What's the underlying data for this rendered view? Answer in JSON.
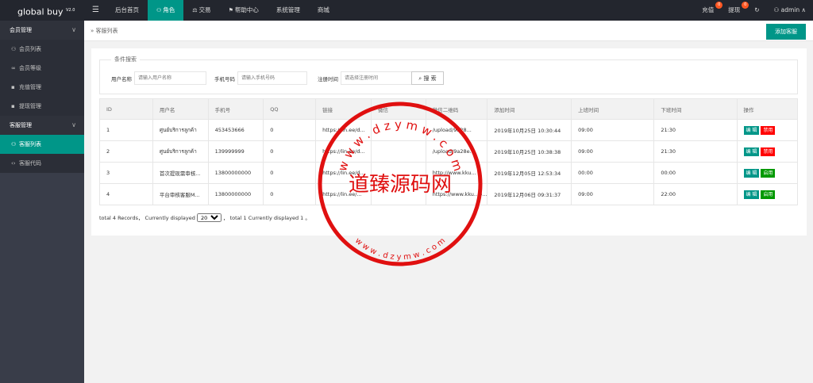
{
  "app": {
    "name": "global buy",
    "version": "V2.0"
  },
  "header": {
    "menu_icon": "menu-icon",
    "nav": [
      {
        "label": "后台首页",
        "icon": ""
      },
      {
        "label": "角色",
        "icon": "user-icon"
      },
      {
        "label": "交易",
        "icon": "scale-icon"
      },
      {
        "label": "帮助中心",
        "icon": "flag-icon"
      },
      {
        "label": "系统管理",
        "icon": ""
      },
      {
        "label": "商城",
        "icon": ""
      }
    ],
    "right": {
      "recharge": {
        "label": "充值",
        "badge": "0"
      },
      "withdraw": {
        "label": "提现",
        "badge": "0"
      },
      "refresh_icon": "refresh-icon",
      "user": {
        "label": "admin",
        "icon": "user-icon"
      }
    }
  },
  "sidebar": {
    "groups": [
      {
        "label": "会员管理",
        "items": [
          {
            "label": "会员列表",
            "icon": "user-icon"
          },
          {
            "label": "会员等级",
            "icon": "link-icon"
          },
          {
            "label": "充值管理",
            "icon": "chat-icon"
          },
          {
            "label": "提现管理",
            "icon": "chat-icon"
          }
        ]
      },
      {
        "label": "客服管理",
        "items": [
          {
            "label": "客服列表",
            "icon": "users-icon",
            "active": true
          },
          {
            "label": "客服代码",
            "icon": "code-icon"
          }
        ]
      }
    ]
  },
  "breadcrumb": {
    "label": "客服列表"
  },
  "toolbar": {
    "add_label": "添加客服"
  },
  "search": {
    "legend": "条件搜索",
    "username": {
      "label": "用户名称",
      "placeholder": "请输入用户名称"
    },
    "phone": {
      "label": "手机号码",
      "placeholder": "请输入手机号码"
    },
    "regtime": {
      "label": "注册时间",
      "placeholder": "请选择注册时间"
    },
    "button": "搜 索"
  },
  "table": {
    "headers": [
      "ID",
      "用户名",
      "手机号",
      "QQ",
      "链接",
      "微信",
      "微信二维码",
      "添加时间",
      "上班时间",
      "下班时间",
      "操作"
    ],
    "rows": [
      {
        "id": "1",
        "name": "ศูนย์บริการลูกค้า",
        "phone": "453453666",
        "qq": "0",
        "link": "https://lin.ee/d...",
        "wechat": "",
        "qr": "/upload/9a28...",
        "added": "2019年10月25日 10:30:44",
        "start": "09:00",
        "end": "21:30",
        "edit": "编 辑",
        "toggle": "禁用",
        "toggle_type": "off"
      },
      {
        "id": "2",
        "name": "ศูนย์บริการลูกค้า",
        "phone": "139999999",
        "qq": "0",
        "link": "https://lin.ee/d...",
        "wechat": "",
        "qr": "/upload/9a28e...",
        "added": "2019年10月25日 10:38:38",
        "start": "09:00",
        "end": "21:30",
        "edit": "编 辑",
        "toggle": "禁用",
        "toggle_type": "off"
      },
      {
        "id": "3",
        "name": "首次提现需审核...",
        "phone": "13800000000",
        "qq": "0",
        "link": "https://lin.ee/d...",
        "wechat": "",
        "qr": "http://www.kku...",
        "added": "2019年12月05日 12:53:34",
        "start": "00:00",
        "end": "00:00",
        "edit": "编 辑",
        "toggle": "启用",
        "toggle_type": "on"
      },
      {
        "id": "4",
        "name": "平台审核客服M...",
        "phone": "13800000000",
        "qq": "0",
        "link": "https://lin.ee/...",
        "wechat": "",
        "qr": "https://www.kku...p...",
        "added": "2019年12月06日 09:31:37",
        "start": "09:00",
        "end": "22:00",
        "edit": "编 辑",
        "toggle": "启用",
        "toggle_type": "on"
      }
    ]
  },
  "pager": {
    "prefix": "total 4 Records， Currently displayed",
    "page_size": "20",
    "suffix": "， total 1 Currently displayed 1 。"
  },
  "watermark": {
    "text": "道臻源码网",
    "url_top": "w w w . d z y m w . c o m",
    "url_bottom": "w w w . d z y m w . c o m",
    "color": "#e01010"
  }
}
